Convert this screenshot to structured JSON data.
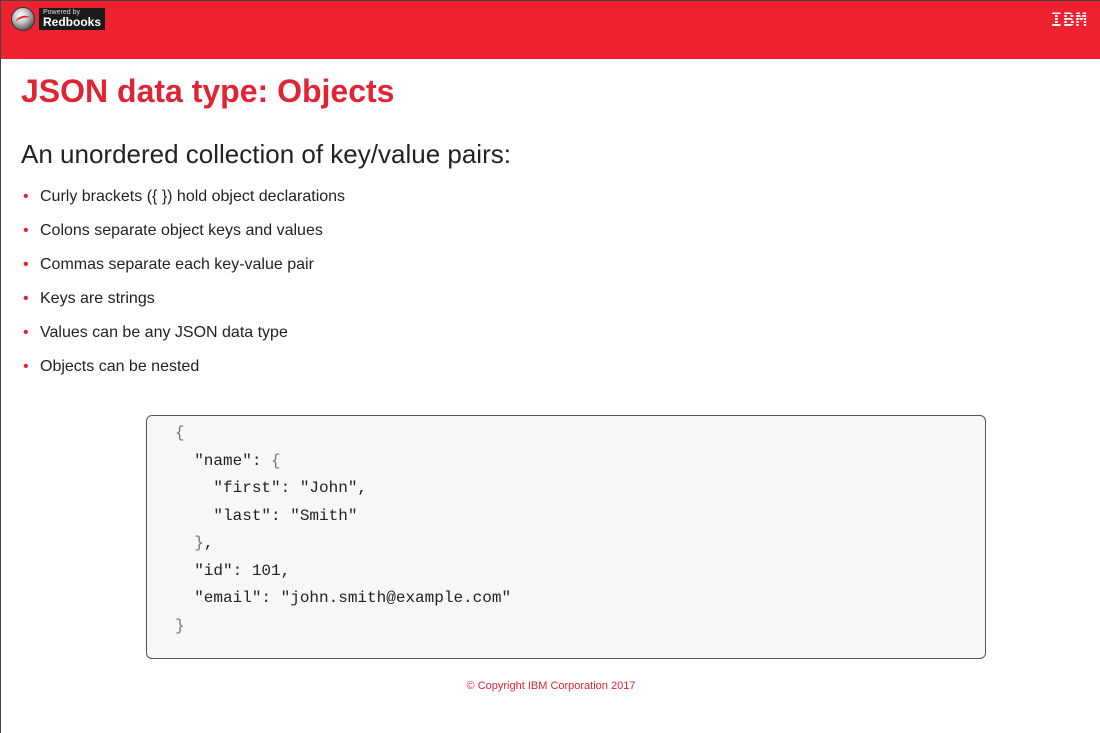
{
  "header": {
    "logo_small": "Powered by",
    "logo_big": "Redbooks",
    "brand": "IBM"
  },
  "slide": {
    "title": "JSON data type: Objects",
    "subtitle": "An unordered collection of key/value pairs:",
    "bullets": [
      "Curly brackets ({  }) hold object declarations",
      "Colons separate object keys and values",
      "Commas separate each key-value pair",
      "Keys are strings",
      "Values can be any JSON data type",
      "Objects can be nested"
    ],
    "code": {
      "l0": "{",
      "l1_key": "\"name\": ",
      "l1_brace": "{",
      "l2": "\"first\": \"John\",",
      "l3": "\"last\": \"Smith\"",
      "l4_brace": "}",
      "l4_comma": ",",
      "l5": "\"id\": 101,",
      "l6": "\"email\": \"john.smith@example.com\"",
      "l7": "}"
    }
  },
  "footer": {
    "copyright": "© Copyright IBM Corporation 2017"
  },
  "colors": {
    "header_red": "#ee2131",
    "title_red": "#e12434",
    "text": "#222222",
    "code_bg": "#f7f7f7"
  },
  "icons": {
    "left_logo": "redbooks-globe-icon",
    "bullet": "bullet-dot-icon"
  }
}
